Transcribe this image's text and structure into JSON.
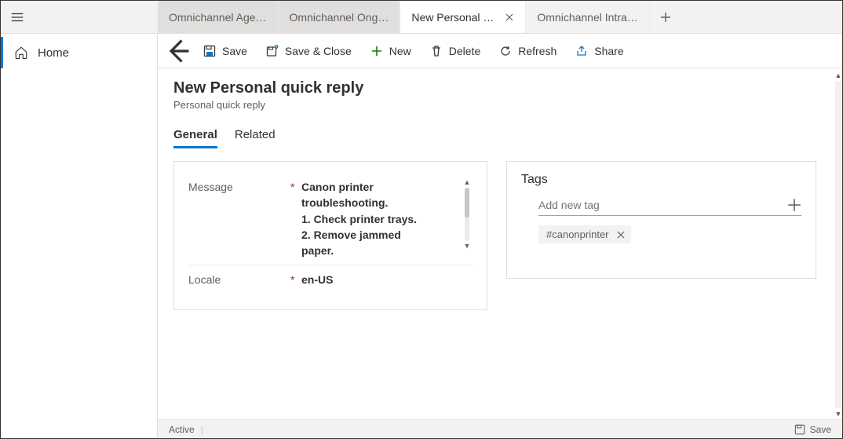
{
  "tabs": [
    {
      "label": "Omnichannel Age…",
      "active": false
    },
    {
      "label": "Omnichannel Ong…",
      "active": false
    },
    {
      "label": "New Personal quick reply",
      "active": true
    },
    {
      "label": "Omnichannel Intra…",
      "active": false
    }
  ],
  "sidebar": {
    "home_label": "Home"
  },
  "commands": {
    "save": "Save",
    "save_close": "Save & Close",
    "new": "New",
    "delete": "Delete",
    "refresh": "Refresh",
    "share": "Share"
  },
  "header": {
    "title": "New Personal quick reply",
    "subtitle": "Personal quick reply"
  },
  "form_tabs": {
    "general": "General",
    "related": "Related"
  },
  "fields": {
    "message_label": "Message",
    "message_value": "Canon printer\ntroubleshooting.\n1. Check printer trays.\n2. Remove jammed\npaper.",
    "locale_label": "Locale",
    "locale_value": "en-US",
    "required_mark": "*"
  },
  "tags_panel": {
    "title": "Tags",
    "add_placeholder": "Add new tag",
    "chips": [
      "#canonprinter"
    ]
  },
  "status": {
    "state": "Active",
    "save": "Save"
  }
}
